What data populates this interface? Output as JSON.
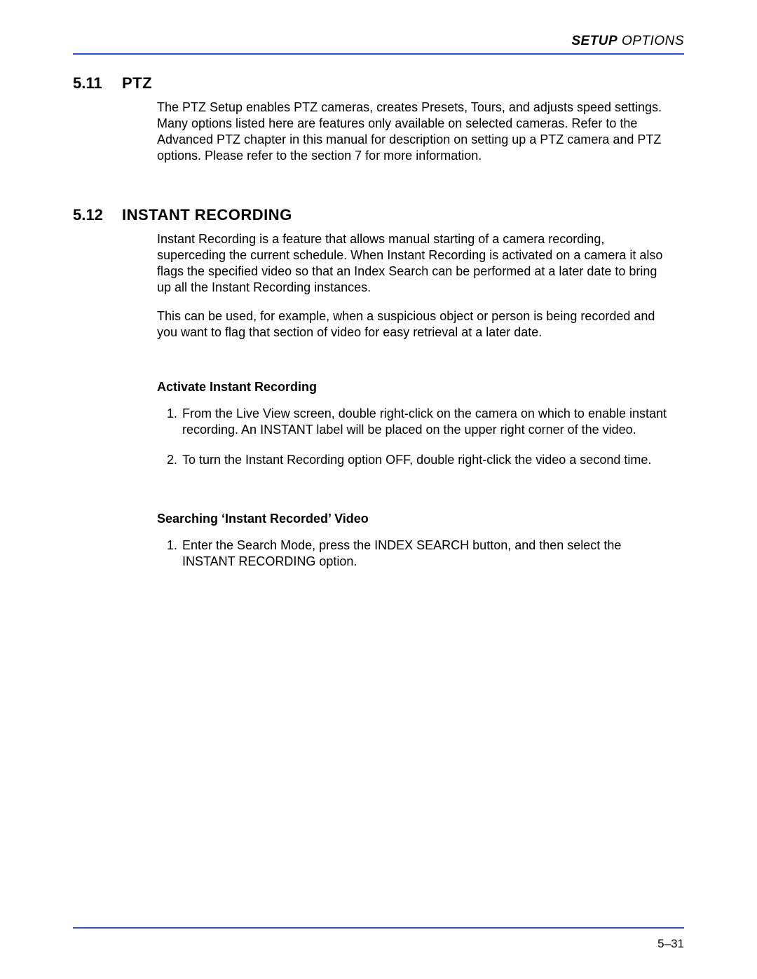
{
  "header": {
    "setup": "SETUP",
    "options": " OPTIONS"
  },
  "section511": {
    "number": "5.11",
    "title": "PTZ",
    "body": "The PTZ Setup enables PTZ cameras, creates Presets, Tours, and adjusts speed settings. Many options listed here are features only available on selected cameras. Refer to the Advanced PTZ chapter in this manual for description on setting up a PTZ camera and PTZ options. Please refer to the section 7 for more information."
  },
  "section512": {
    "number": "5.12",
    "title": "INSTANT RECORDING",
    "para1": "Instant Recording is a feature that allows manual starting of a camera recording, superceding the current schedule. When Instant Recording is activated on a camera it also flags the specified video so that an Index Search can be performed at a later date to bring up all the Instant Recording instances.",
    "para2": "This can be used, for example, when a suspicious object or person is being recorded and you want to flag that section of video for easy retrieval at a later date.",
    "sub1": {
      "heading": "Activate Instant Recording",
      "steps": [
        "From the Live View screen, double right-click on the camera on which to enable instant recording. An INSTANT label will be placed on the upper right corner of the video.",
        "To turn the Instant Recording option OFF, double right-click the video a second time."
      ]
    },
    "sub2": {
      "heading": "Searching ‘Instant Recorded’ Video",
      "steps": [
        "Enter the Search Mode, press the INDEX SEARCH button, and then select the INSTANT RECORDING option."
      ]
    }
  },
  "page_number": "5–31"
}
